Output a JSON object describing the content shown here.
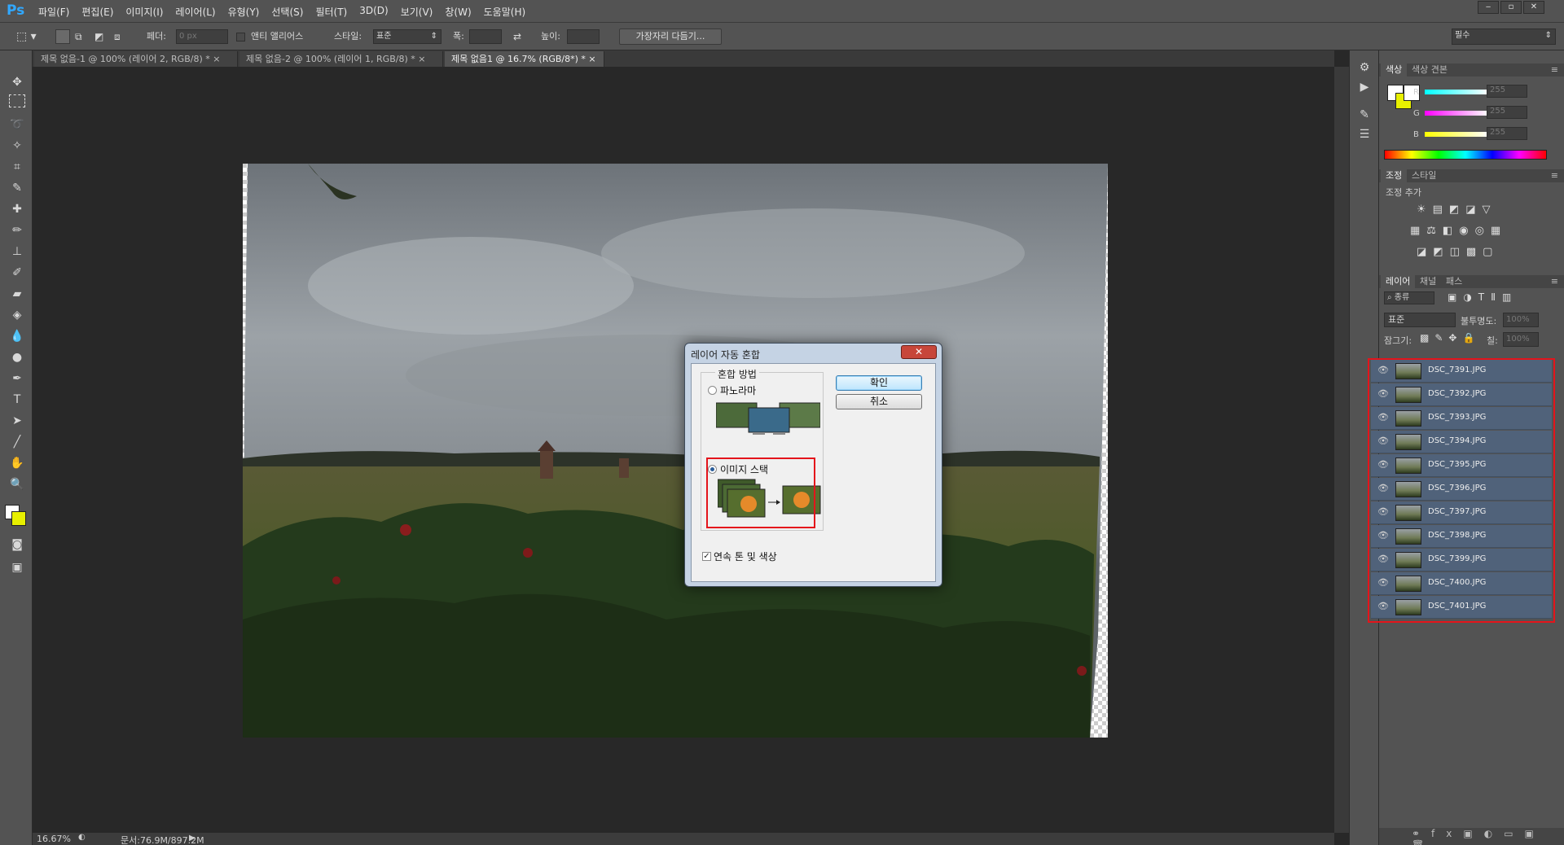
{
  "app": {
    "logo": "Ps"
  },
  "menu": [
    "파일(F)",
    "편집(E)",
    "이미지(I)",
    "레이어(L)",
    "유형(Y)",
    "선택(S)",
    "필터(T)",
    "3D(D)",
    "보기(V)",
    "창(W)",
    "도움말(H)"
  ],
  "window_controls": [
    "‒",
    "▫",
    "✕"
  ],
  "options": {
    "feather_label": "페더:",
    "feather_value": "0 px",
    "antialias": "앤티 앨리어스",
    "style_label": "스타일:",
    "style_value": "표준",
    "width_label": "폭:",
    "height_label": "높이:",
    "refine_button": "가장자리 다듬기...",
    "workspace": "필수"
  },
  "tabs": [
    "제목 없음-1 @ 100% (레이어 2, RGB/8) *",
    "제목 없음-2 @ 100% (레이어 1, RGB/8) *",
    "제목 없음1 @ 16.7% (RGB/8*) *"
  ],
  "tab_close": "×",
  "status": {
    "zoom": "16.67%",
    "doc": "문서:76.9M/897.2M"
  },
  "dialog": {
    "title": "레이어 자동 혼합",
    "group_label": "혼합 방법",
    "option_panorama": "파노라마",
    "option_stack": "이미지 스택",
    "checkbox_label": "연속 톤 및 색상",
    "ok": "확인",
    "cancel": "취소",
    "close": "✕"
  },
  "color_panel": {
    "tabs": [
      "색상",
      "색상 견본"
    ],
    "channels": [
      "R",
      "G",
      "B"
    ],
    "values": [
      "255",
      "255",
      "255"
    ]
  },
  "adjust_panel": {
    "tabs": [
      "조정",
      "스타일"
    ],
    "subtitle": "조정 추가"
  },
  "layers_panel": {
    "tabs": [
      "레이어",
      "채널",
      "패스"
    ],
    "kind": "종류",
    "blend": "표준",
    "opacity_label": "불투명도:",
    "opacity_value": "100%",
    "lock_label": "잠그기:",
    "fill_label": "칠:",
    "fill_value": "100%",
    "layers": [
      "DSC_7391.JPG",
      "DSC_7392.JPG",
      "DSC_7393.JPG",
      "DSC_7394.JPG",
      "DSC_7395.JPG",
      "DSC_7396.JPG",
      "DSC_7397.JPG",
      "DSC_7398.JPG",
      "DSC_7399.JPG",
      "DSC_7400.JPG",
      "DSC_7401.JPG"
    ]
  },
  "colors": {
    "accent": "#31a8ff",
    "highlight": "#e4141b",
    "layer_selected": "#50627a",
    "foreground": "#ffffff",
    "background": "#e8f000"
  }
}
